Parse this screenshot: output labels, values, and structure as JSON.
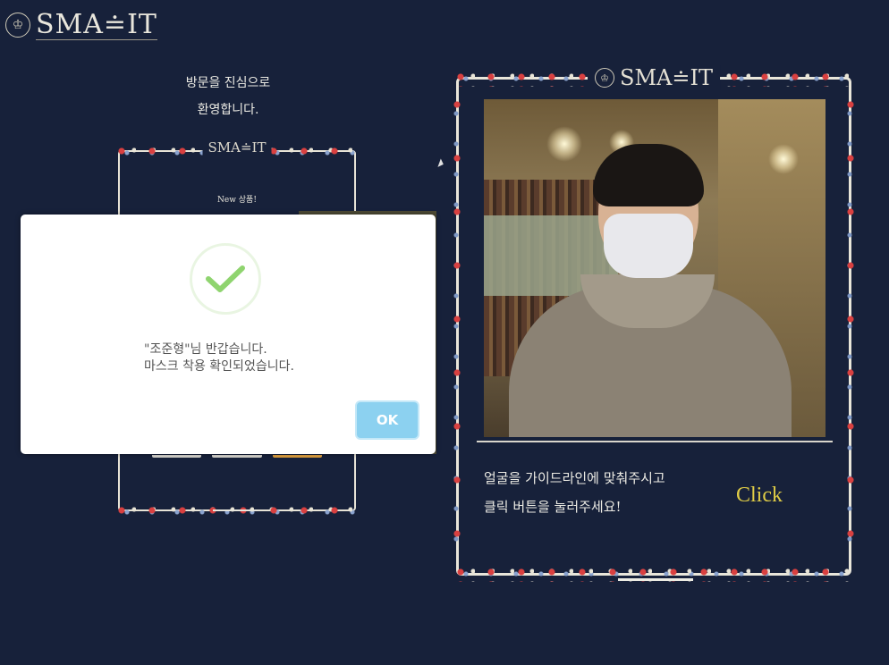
{
  "brand": {
    "logo_text": "SMA≐IT",
    "crest_glyph": "♔"
  },
  "welcome": {
    "line1": "방문을 진심으로",
    "line2": "환영합니다."
  },
  "small_frame": {
    "logo_text": "SMA≐IT",
    "new_label": "New 상품!"
  },
  "camera_frame": {
    "logo_text": "SMA≐IT",
    "guide_line1": "얼굴을 가이드라인에 맞춰주시고",
    "guide_line2": "클릭 버튼을 눌러주세요!",
    "click_label": "Click"
  },
  "dialog": {
    "message": "\"조준형\"님 반갑습니다.\n마스크 착용 확인되었습니다.",
    "ok_label": "OK",
    "icon": "checkmark-icon",
    "accent_color": "#8cd1f0",
    "check_color": "#8fd46f"
  },
  "colors": {
    "background": "#17213a",
    "click_text": "#dfcc46"
  }
}
